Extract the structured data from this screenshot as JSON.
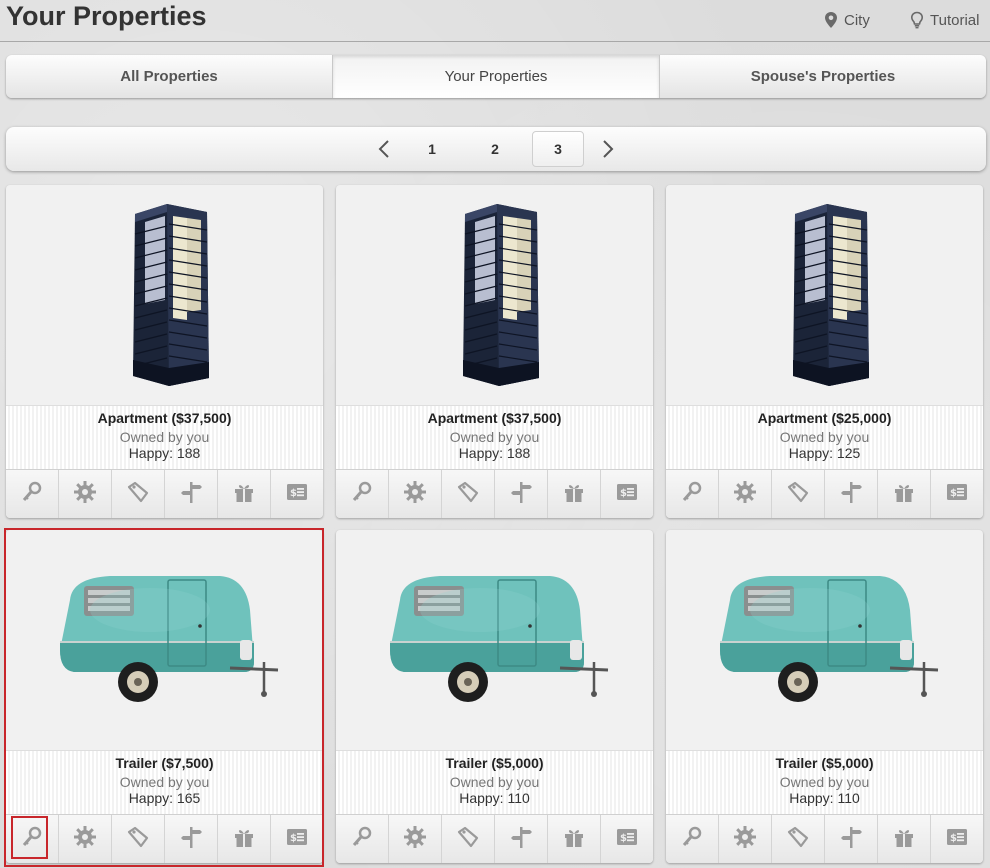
{
  "header": {
    "title": "Your Properties",
    "city_label": "City",
    "tutorial_label": "Tutorial"
  },
  "tabs": [
    {
      "label": "All Properties",
      "active": false
    },
    {
      "label": "Your Properties",
      "active": true
    },
    {
      "label": "Spouse's Properties",
      "active": false
    }
  ],
  "pagination": {
    "prev": "❮",
    "next": "❯",
    "pages": [
      "1",
      "2",
      "3"
    ],
    "current": "3"
  },
  "properties": [
    {
      "title": "Apartment ($37,500)",
      "owner": "Owned by you",
      "happy": "Happy: 188",
      "kind": "apartment"
    },
    {
      "title": "Apartment ($37,500)",
      "owner": "Owned by you",
      "happy": "Happy: 188",
      "kind": "apartment"
    },
    {
      "title": "Apartment ($25,000)",
      "owner": "Owned by you",
      "happy": "Happy: 125",
      "kind": "apartment"
    },
    {
      "title": "Trailer ($7,500)",
      "owner": "Owned by you",
      "happy": "Happy: 165",
      "kind": "trailer"
    },
    {
      "title": "Trailer ($5,000)",
      "owner": "Owned by you",
      "happy": "Happy: 110",
      "kind": "trailer"
    },
    {
      "title": "Trailer ($5,000)",
      "owner": "Owned by you",
      "happy": "Happy: 110",
      "kind": "trailer"
    }
  ],
  "action_icons": [
    "key-icon",
    "gear-icon",
    "price-tag-icon",
    "signpost-icon",
    "gift-icon",
    "money-icon"
  ],
  "colors": {
    "accent_highlight": "#c8262b",
    "icon_gray": "#9a9a9a",
    "trailer_teal": "#5fb3ae"
  }
}
